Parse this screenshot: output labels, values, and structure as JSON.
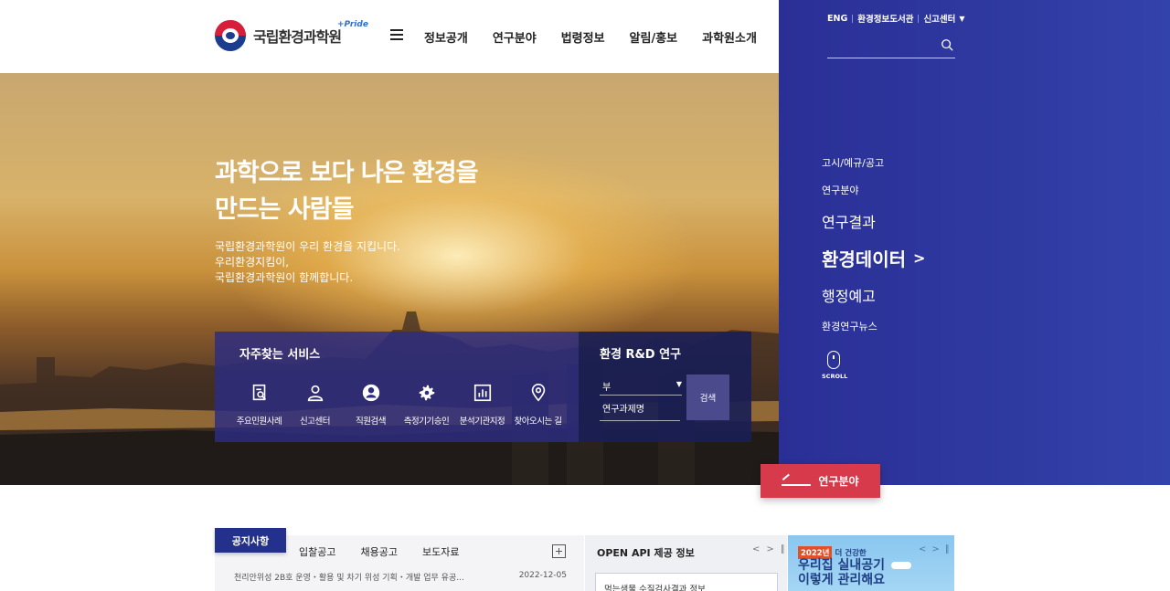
{
  "header": {
    "logo_text": "국립환경과학원",
    "logo_tag": "+Pride",
    "nav": [
      "정보공개",
      "연구분야",
      "법령정보",
      "알림/홍보",
      "과학원소개"
    ]
  },
  "util": {
    "eng": "ENG",
    "library": "환경정보도서관",
    "report": "신고센터"
  },
  "hero": {
    "title_line1": "과학으로 보다 나은 환경을",
    "title_line2": "만드는 사람들",
    "sub_line1": "국립환경과학원이 우리 환경을 지킵니다.",
    "sub_line2": "우리환경지킴이,",
    "sub_line3": "국립환경과학원이 함께합니다."
  },
  "services": {
    "title": "자주찾는 서비스",
    "items": [
      {
        "label": "주요민원사례",
        "icon": "document-search-icon"
      },
      {
        "label": "신고센터",
        "icon": "person-icon"
      },
      {
        "label": "직원검색",
        "icon": "user-circle-icon"
      },
      {
        "label": "측정기기승인",
        "icon": "gear-icon"
      },
      {
        "label": "분석기관지정",
        "icon": "bar-chart-icon"
      },
      {
        "label": "찾아오시는 길",
        "icon": "location-pin-icon"
      }
    ]
  },
  "rnd": {
    "title": "환경 R&D 연구",
    "select_value": "부",
    "input_placeholder": "연구과제명",
    "search_label": "검색"
  },
  "side_menu": {
    "items": [
      "고시/예규/공고",
      "연구분야",
      "연구결과",
      "환경데이터",
      "행정예고",
      "환경연구뉴스"
    ],
    "scroll": "SCROLL"
  },
  "cta": {
    "label": "연구분야"
  },
  "notice": {
    "active_tab": "공지사항",
    "tabs": [
      "입찰공고",
      "채용공고",
      "보도자료"
    ],
    "rows": [
      {
        "title": "천리안위성 2B호 운영・활용 및 차기 위성 기획・개발 업무 유공...",
        "date": "2022-12-05"
      }
    ]
  },
  "api": {
    "title": "OPEN API 제공 정보",
    "card": "먹는샘물 수질검사결과 정보"
  },
  "banner": {
    "year": "2022년",
    "tag": "더 건강한",
    "line1": "우리집 실내공기",
    "line2": "이렇게 관리해요"
  }
}
